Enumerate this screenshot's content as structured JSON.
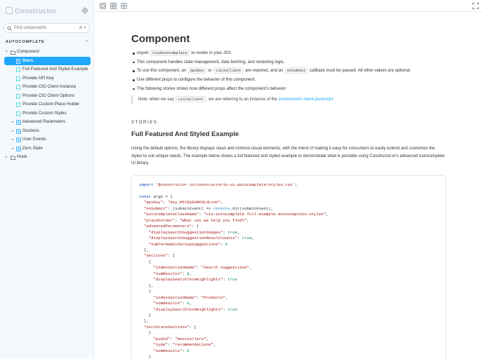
{
  "sidebar": {
    "logo": "Constructor",
    "search_placeholder": "Find components",
    "search_shortcut": "⌘ K",
    "section_title": "AUTOCOMPLETE",
    "tree": [
      {
        "label": "Component",
        "icon": "folder-icon",
        "chevron": "▾",
        "level": 0
      },
      {
        "label": "Docs",
        "icon": "doc-icon",
        "level": 1,
        "selected": true
      },
      {
        "label": "Full Featured And Styled Example",
        "icon": "story-icon",
        "level": 1
      },
      {
        "label": "Provide API Key",
        "icon": "story-icon",
        "level": 1
      },
      {
        "label": "Provide CIO Client Instance",
        "icon": "story-icon",
        "level": 1
      },
      {
        "label": "Provide CIO Client Options",
        "icon": "story-icon",
        "level": 1
      },
      {
        "label": "Provide Custom Place Holder",
        "icon": "story-icon",
        "level": 1
      },
      {
        "label": "Provide Custom Styles",
        "icon": "story-icon",
        "level": 1
      },
      {
        "label": "Advanced Parameters",
        "icon": "component-icon",
        "chevron": "▸",
        "level": 1
      },
      {
        "label": "Sections",
        "icon": "component-icon",
        "chevron": "▸",
        "level": 1
      },
      {
        "label": "User Events",
        "icon": "component-icon",
        "chevron": "▸",
        "level": 1
      },
      {
        "label": "Zero State",
        "icon": "component-icon",
        "chevron": "▸",
        "level": 1
      },
      {
        "label": "Hook",
        "icon": "folder-icon",
        "chevron": "▸",
        "level": 0
      }
    ]
  },
  "toolbar": {
    "icons": [
      "zoom-icon",
      "grid-icon",
      "outline-icon"
    ],
    "fullscreen_icon": "fullscreen-icon"
  },
  "doc": {
    "title": "Component",
    "bullets": {
      "b1_pre": "import",
      "b1_code": "CioAutocomplete",
      "b1_post": "to render in your JSX.",
      "b2": "This component handles state management, data fetching, and rendering logic.",
      "b3_pre": "To use this component, an",
      "b3_code1": "apiKey",
      "b3_or": "or",
      "b3_code2": "cioJsClient",
      "b3_mid": "are required, and an",
      "b3_code3": "onSubmit",
      "b3_post": "callback must be passed. All other values are optional.",
      "b4": "Use different props to configure the behavior of this component.",
      "b5": "The following stories shows how different props affect the component's behavior"
    },
    "note_pre": "Note: when we say",
    "note_code": "cioJsClient",
    "note_mid": ", we are referring to an instance of the",
    "note_link": "constructorio-client-javascript",
    "stories_label": "STORIES",
    "story_title": "Full Featured And Styled Example",
    "story_desc": "Using the default options, the library displays clean and minimal visual elements, with the intent of making it easy for consumers to easily extend and customize the styles to suit unique needs. The example below shows a full featured and styled example to demonstrate what is possible using Constructor.io's advanced Autocomplete UI library."
  },
  "colors": {
    "accent": "#1ea7fd",
    "keyword": "#0033b3",
    "string": "#a31515",
    "boolean": "#0a8a5a",
    "function": "#1e88c7"
  }
}
